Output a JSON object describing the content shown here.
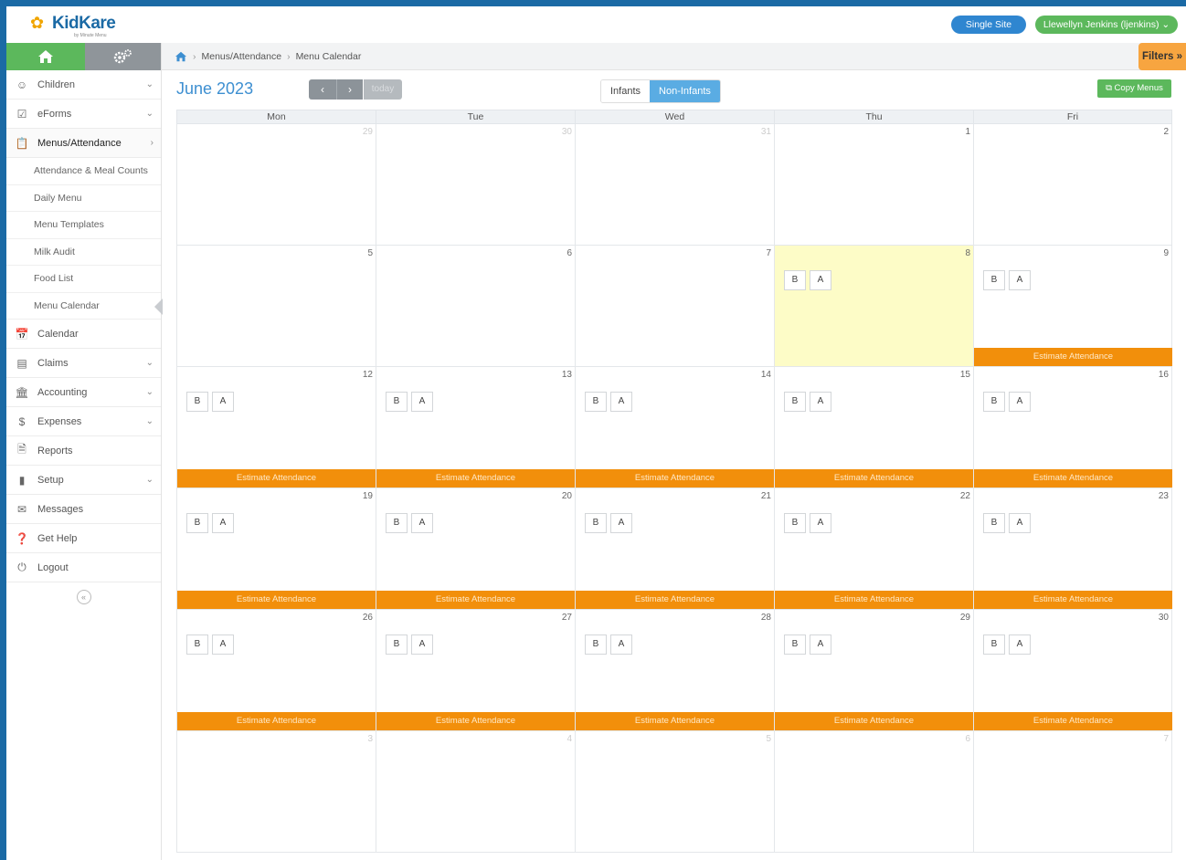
{
  "app": {
    "logo_text": "KidKare",
    "logo_tagline": "by Minute Menu",
    "single_site_label": "Single Site",
    "user_label": "Llewellyn Jenkins (ljenkins)"
  },
  "sidebar": {
    "items": [
      {
        "label": "Children",
        "icon": "child-face-icon",
        "has_chevron": true
      },
      {
        "label": "eForms",
        "icon": "checkbox-form-icon",
        "has_chevron": true
      },
      {
        "label": "Menus/Attendance",
        "icon": "clipboard-icon",
        "has_chevron": true,
        "active": true
      }
    ],
    "subitems": [
      {
        "label": "Attendance & Meal Counts"
      },
      {
        "label": "Daily Menu"
      },
      {
        "label": "Menu Templates"
      },
      {
        "label": "Milk Audit"
      },
      {
        "label": "Food List"
      },
      {
        "label": "Menu Calendar",
        "current": true
      }
    ],
    "items_after": [
      {
        "label": "Calendar",
        "icon": "calendar-icon",
        "has_chevron": false
      },
      {
        "label": "Claims",
        "icon": "claims-icon",
        "has_chevron": true
      },
      {
        "label": "Accounting",
        "icon": "bank-icon",
        "has_chevron": true
      },
      {
        "label": "Expenses",
        "icon": "dollar-icon",
        "has_chevron": true
      },
      {
        "label": "Reports",
        "icon": "report-icon",
        "has_chevron": false
      },
      {
        "label": "Setup",
        "icon": "setup-icon",
        "has_chevron": true
      },
      {
        "label": "Messages",
        "icon": "envelope-icon",
        "has_chevron": false
      },
      {
        "label": "Get Help",
        "icon": "help-icon",
        "has_chevron": false
      },
      {
        "label": "Logout",
        "icon": "power-icon",
        "has_chevron": false
      }
    ]
  },
  "breadcrumb": {
    "items": [
      "Menus/Attendance",
      "Menu Calendar"
    ],
    "filters_label": "Filters"
  },
  "calendar": {
    "month_title": "June 2023",
    "today_label": "today",
    "toggle": {
      "infants": "Infants",
      "non_infants": "Non-Infants"
    },
    "copy_menus_label": "Copy Menus",
    "days_of_week": [
      "Mon",
      "Tue",
      "Wed",
      "Thu",
      "Fri"
    ],
    "meal_labels": [
      "B",
      "A"
    ],
    "estimate_label": "Estimate Attendance",
    "weeks": [
      [
        {
          "n": "29",
          "muted": true
        },
        {
          "n": "30",
          "muted": true
        },
        {
          "n": "31",
          "muted": true
        },
        {
          "n": "1"
        },
        {
          "n": "2"
        }
      ],
      [
        {
          "n": "5"
        },
        {
          "n": "6"
        },
        {
          "n": "7"
        },
        {
          "n": "8",
          "meals": true,
          "highlight": true
        },
        {
          "n": "9",
          "meals": true,
          "estimate": true
        }
      ],
      [
        {
          "n": "12",
          "meals": true,
          "estimate": true
        },
        {
          "n": "13",
          "meals": true,
          "estimate": true
        },
        {
          "n": "14",
          "meals": true,
          "estimate": true
        },
        {
          "n": "15",
          "meals": true,
          "estimate": true
        },
        {
          "n": "16",
          "meals": true,
          "estimate": true
        }
      ],
      [
        {
          "n": "19",
          "meals": true,
          "estimate": true
        },
        {
          "n": "20",
          "meals": true,
          "estimate": true
        },
        {
          "n": "21",
          "meals": true,
          "estimate": true
        },
        {
          "n": "22",
          "meals": true,
          "estimate": true
        },
        {
          "n": "23",
          "meals": true,
          "estimate": true
        }
      ],
      [
        {
          "n": "26",
          "meals": true,
          "estimate": true
        },
        {
          "n": "27",
          "meals": true,
          "estimate": true
        },
        {
          "n": "28",
          "meals": true,
          "estimate": true
        },
        {
          "n": "29",
          "meals": true,
          "estimate": true
        },
        {
          "n": "30",
          "meals": true,
          "estimate": true
        }
      ],
      [
        {
          "n": "3",
          "muted": true
        },
        {
          "n": "4",
          "muted": true
        },
        {
          "n": "5",
          "muted": true
        },
        {
          "n": "6",
          "muted": true
        },
        {
          "n": "7",
          "muted": true
        }
      ]
    ]
  },
  "colors": {
    "brand_blue": "#1b6aa5",
    "accent_green": "#5cb85c",
    "estimate_orange": "#f28f0b",
    "today_highlight": "#fdfcc7"
  }
}
